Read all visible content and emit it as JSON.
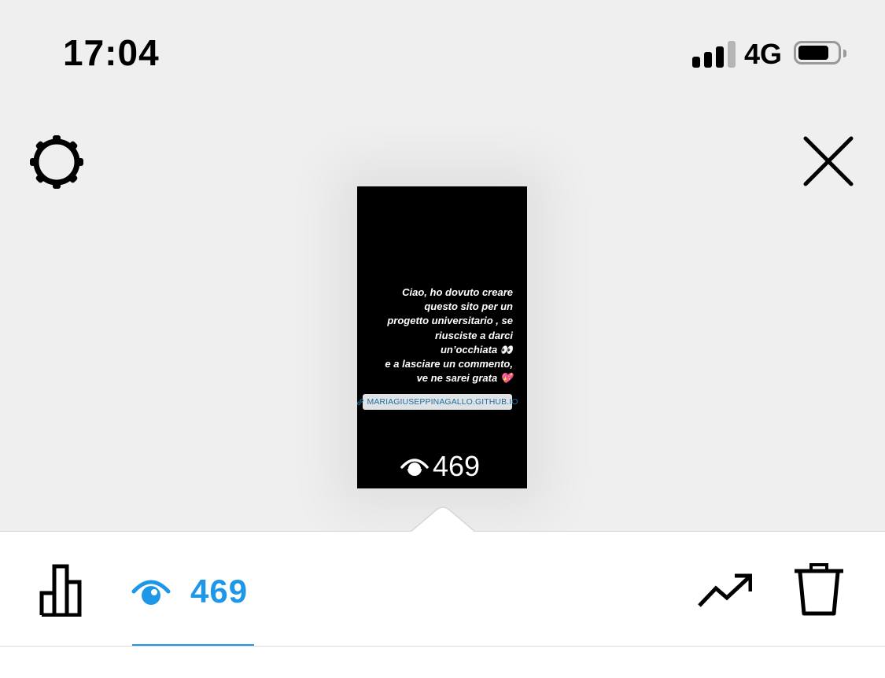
{
  "status_bar": {
    "time": "17:04",
    "network": "4G"
  },
  "story": {
    "text": "Ciao, ho dovuto creare\nquesto sito per un\nprogetto universitario , se\nriusciste a darci\nun’occhiata 👀\ne a lasciare un commento,\nve ne sarei grata 💖",
    "link": "MARIAGIUSEPPINAGALLO.GITHUB.IO",
    "views": "469"
  },
  "bottom_bar": {
    "views_count": "469"
  },
  "icons": {
    "settings": "gear-icon",
    "close": "close-icon",
    "insights": "bar-chart-icon",
    "views": "eye-icon",
    "promote": "trending-up-icon",
    "delete": "trash-icon"
  },
  "colors": {
    "accent": "#1e97e8",
    "background": "#efefef",
    "panel": "#ffffff"
  }
}
